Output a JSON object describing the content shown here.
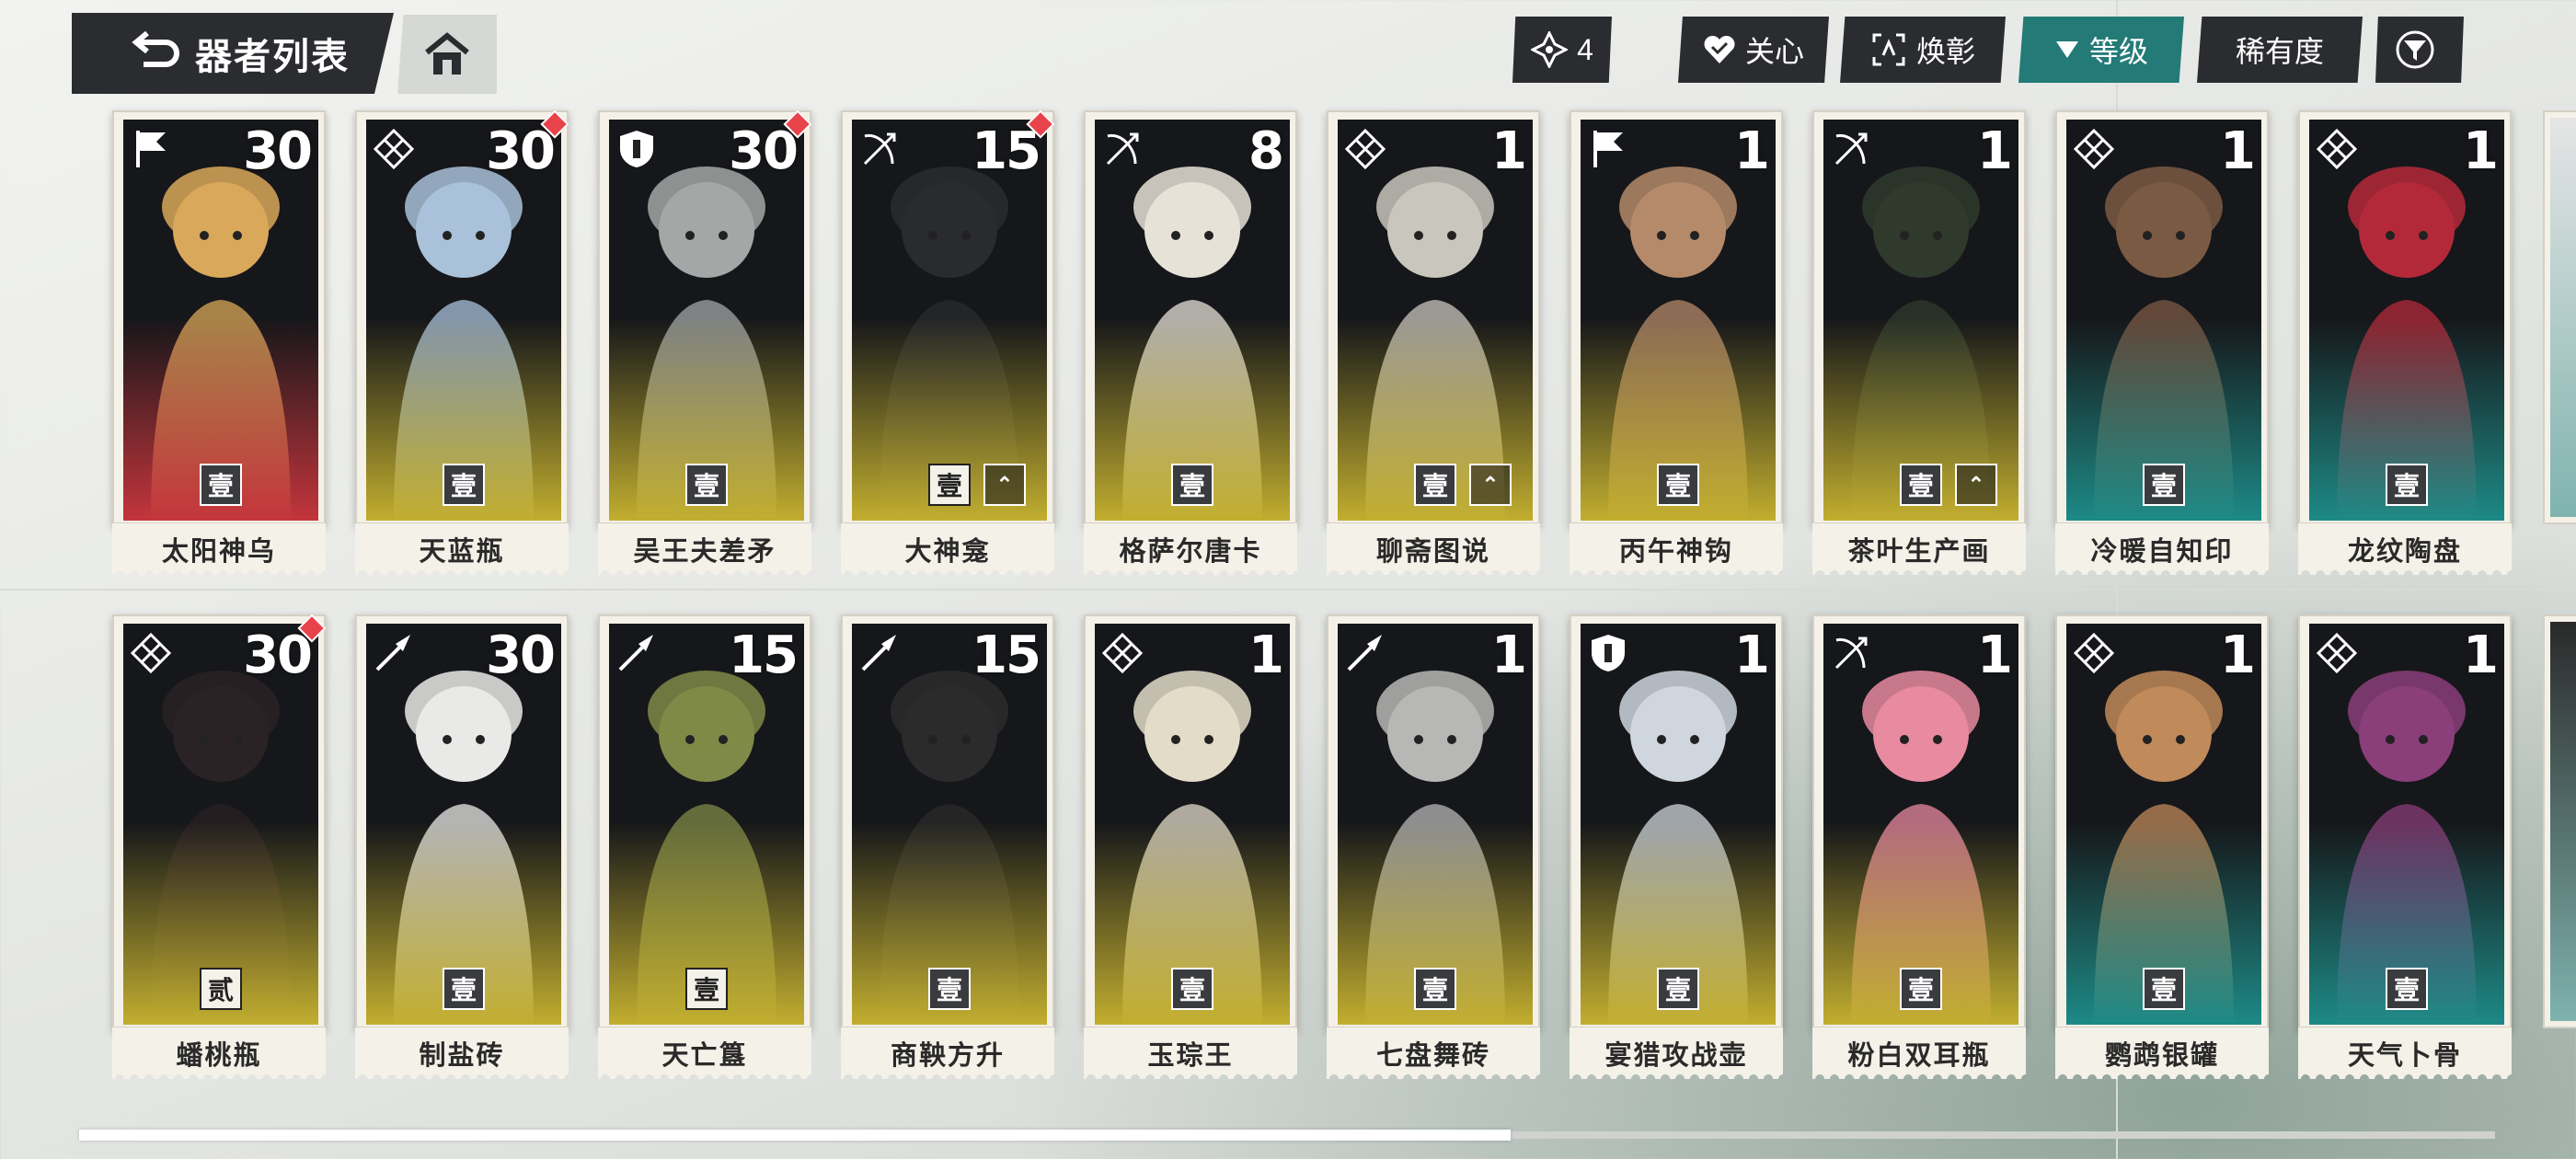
{
  "header": {
    "title": "器者列表",
    "back_icon": "back-arrow-icon",
    "home_icon": "home-icon"
  },
  "toolbar": {
    "count_label": "4",
    "care_label": "关心",
    "refresh_label": "焕彰",
    "level_label": "等级",
    "rarity_label": "稀有度",
    "filter_icon": "filter-icon",
    "active_color": "#237a77"
  },
  "rows": [
    [
      {
        "name": "太阳神乌",
        "level": "30",
        "cls": "flag",
        "rank": "壹",
        "pip": false,
        "up": false,
        "fade": "#c4353c",
        "skin": "#d9a85a"
      },
      {
        "name": "天蓝瓶",
        "level": "30",
        "cls": "knot",
        "rank": "壹",
        "pip": true,
        "up": false,
        "fade": "#c2ae2f",
        "skin": "#a9c1d9"
      },
      {
        "name": "吴王夫差矛",
        "level": "30",
        "cls": "shield",
        "rank": "壹",
        "pip": true,
        "up": false,
        "fade": "#c2ae2f",
        "skin": "#a3a7a6"
      },
      {
        "name": "大神龛",
        "level": "15",
        "cls": "bow",
        "rank": "壹",
        "pip": true,
        "up": true,
        "light": true,
        "fade": "#c2ae2f",
        "skin": "#2a2b2e"
      },
      {
        "name": "格萨尔唐卡",
        "level": "8",
        "cls": "bow",
        "rank": "壹",
        "pip": false,
        "up": false,
        "fade": "#c2ae2f",
        "skin": "#e6e2d8"
      },
      {
        "name": "聊斋图说",
        "level": "1",
        "cls": "knot",
        "rank": "壹",
        "pip": false,
        "up": true,
        "fade": "#c2ae2f",
        "skin": "#c9c6be"
      },
      {
        "name": "丙午神钩",
        "level": "1",
        "cls": "flag",
        "rank": "壹",
        "pip": false,
        "up": false,
        "fade": "#c2ae2f",
        "skin": "#b48a6a"
      },
      {
        "name": "茶叶生产画",
        "level": "1",
        "cls": "bow",
        "rank": "壹",
        "pip": false,
        "up": true,
        "fade": "#c2ae2f",
        "skin": "#2f3a2d"
      },
      {
        "name": "冷暖自知印",
        "level": "1",
        "cls": "knot",
        "rank": "壹",
        "pip": false,
        "up": false,
        "fade": "#1d8a86",
        "skin": "#7b5a44"
      },
      {
        "name": "龙纹陶盘",
        "level": "1",
        "cls": "knot",
        "rank": "壹",
        "pip": false,
        "up": false,
        "fade": "#1d8a86",
        "skin": "#b4293a"
      }
    ],
    [
      {
        "name": "蟠桃瓶",
        "level": "30",
        "cls": "knot",
        "rank": "贰",
        "pip": true,
        "up": false,
        "light": true,
        "fade": "#c2ae2f",
        "skin": "#2a2224"
      },
      {
        "name": "制盐砖",
        "level": "30",
        "cls": "brush",
        "rank": "壹",
        "pip": false,
        "up": false,
        "fade": "#c2ae2f",
        "skin": "#e9e9e7"
      },
      {
        "name": "天亡簋",
        "level": "15",
        "cls": "brush",
        "rank": "壹",
        "pip": false,
        "up": false,
        "light": true,
        "fade": "#c2ae2f",
        "skin": "#7f8a48"
      },
      {
        "name": "商鞅方升",
        "level": "15",
        "cls": "brush",
        "rank": "壹",
        "pip": false,
        "up": false,
        "fade": "#c2ae2f",
        "skin": "#2b2b2b"
      },
      {
        "name": "玉琮王",
        "level": "1",
        "cls": "knot",
        "rank": "壹",
        "pip": false,
        "up": false,
        "fade": "#c2ae2f",
        "skin": "#e3dcc9"
      },
      {
        "name": "七盘舞砖",
        "level": "1",
        "cls": "brush",
        "rank": "壹",
        "pip": false,
        "up": false,
        "fade": "#c2ae2f",
        "skin": "#b7b7b5"
      },
      {
        "name": "宴猎攻战壶",
        "level": "1",
        "cls": "shield",
        "rank": "壹",
        "pip": false,
        "up": false,
        "fade": "#c2ae2f",
        "skin": "#cfd6de"
      },
      {
        "name": "粉白双耳瓶",
        "level": "1",
        "cls": "bow",
        "rank": "壹",
        "pip": false,
        "up": false,
        "fade": "#c2ae2f",
        "skin": "#e88aa0"
      },
      {
        "name": "鹦鹉银罐",
        "level": "1",
        "cls": "knot",
        "rank": "壹",
        "pip": false,
        "up": false,
        "fade": "#1d8a86",
        "skin": "#c08a5a"
      },
      {
        "name": "天气卜骨",
        "level": "1",
        "cls": "knot",
        "rank": "壹",
        "pip": false,
        "up": false,
        "fade": "#1d8a86",
        "skin": "#8a3e7a"
      }
    ]
  ]
}
